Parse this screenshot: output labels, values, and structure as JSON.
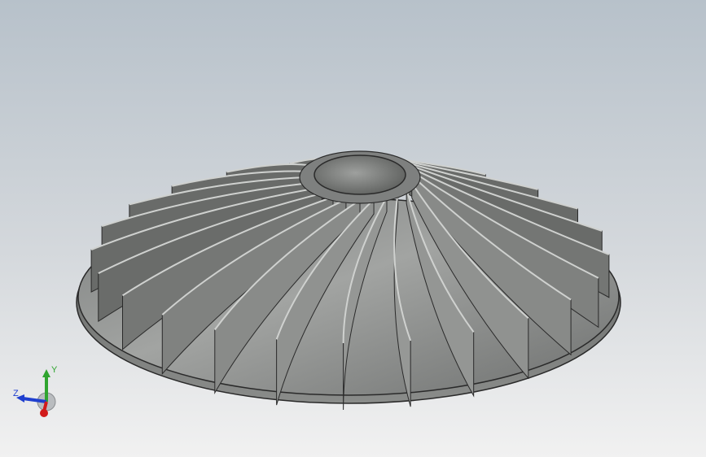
{
  "viewport": {
    "background_top": "#b7c1ca",
    "background_bottom": "#f1f1f1"
  },
  "model": {
    "material_color": "#8f9190",
    "edge_color": "#2a2a2a",
    "blade_count": 24
  },
  "triad": {
    "x_color": "#d11a1a",
    "y_color": "#2fa52f",
    "z_color": "#1f3fcf",
    "y_label": "Y",
    "z_label": "Z"
  }
}
